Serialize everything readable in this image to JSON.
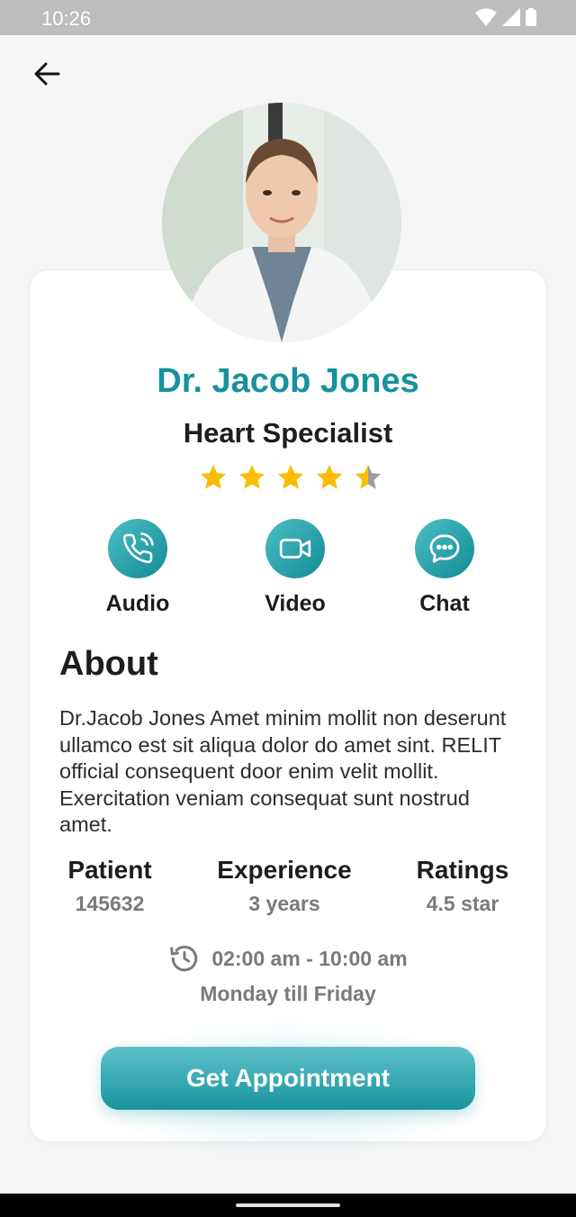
{
  "status_bar": {
    "time": "10:26"
  },
  "doctor": {
    "name": "Dr. Jacob Jones",
    "specialty": "Heart Specialist",
    "rating": 4.5
  },
  "actions": [
    {
      "label": "Audio",
      "icon": "phone-icon"
    },
    {
      "label": "Video",
      "icon": "video-camera-icon"
    },
    {
      "label": "Chat",
      "icon": "chat-bubble-icon"
    }
  ],
  "about": {
    "title": "About",
    "text": "Dr.Jacob Jones Amet minim mollit non deserunt ullamco est sit aliqua dolor do amet sint. RELIT official consequent door enim velit mollit. Exercitation veniam consequat sunt nostrud amet."
  },
  "stats": [
    {
      "label": "Patient",
      "value": "145632"
    },
    {
      "label": "Experience",
      "value": "3 years"
    },
    {
      "label": "Ratings",
      "value": "4.5 star"
    }
  ],
  "schedule": {
    "time": "02:00 am - 10:00 am",
    "days": "Monday till Friday"
  },
  "cta": {
    "label": "Get Appointment"
  },
  "colors": {
    "accent": "#17929d",
    "star": "#fbbc04",
    "star_empty": "#9e9e9e",
    "background": "#f6f6f6"
  }
}
